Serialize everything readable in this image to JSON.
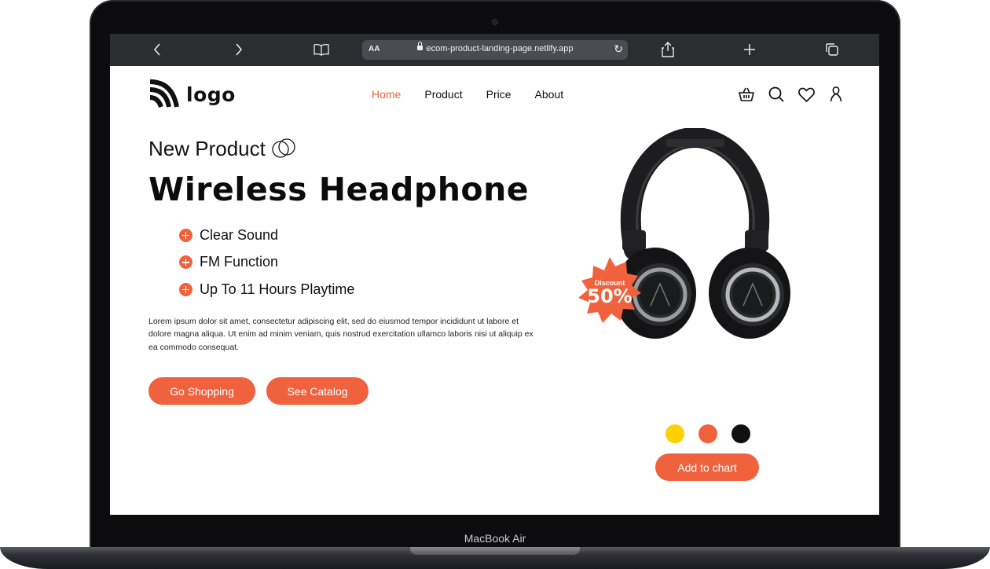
{
  "device": {
    "label": "MacBook Air"
  },
  "browser": {
    "url": "ecom-product-landing-page.netlify.app",
    "text_size_label": "AA",
    "icons": [
      "chevron-left-icon",
      "chevron-right-icon",
      "book-icon",
      "reload-icon",
      "share-icon",
      "plus-icon",
      "tabs-icon"
    ]
  },
  "header": {
    "logo_text": "logo",
    "nav": [
      {
        "label": "Home",
        "active": true
      },
      {
        "label": "Product",
        "active": false
      },
      {
        "label": "Price",
        "active": false
      },
      {
        "label": "About",
        "active": false
      }
    ],
    "icons": [
      "basket-icon",
      "search-icon",
      "heart-icon",
      "user-icon"
    ]
  },
  "hero": {
    "eyebrow": "New Product",
    "title": "Wireless Headphone",
    "features": [
      "Clear Sound",
      "FM Function",
      "Up To 11 Hours Playtime"
    ],
    "description": "Lorem ipsum dolor sit amet, consectetur adipiscing elit, sed do eiusmod tempor incididunt ut labore et dolore magna aliqua. Ut enim ad minim veniam, quis nostrud exercitation ullamco laboris nisi ut aliquip ex ea commodo consequat.",
    "primary_button": "Go Shopping",
    "secondary_button": "See Catalog"
  },
  "product": {
    "badge_small": "Discount",
    "badge_large": "50%",
    "swatches": [
      "#ffd000",
      "#f0623e",
      "#111111"
    ],
    "cart_button": "Add to chart"
  },
  "colors": {
    "accent": "#f0623e",
    "text": "#111111"
  }
}
